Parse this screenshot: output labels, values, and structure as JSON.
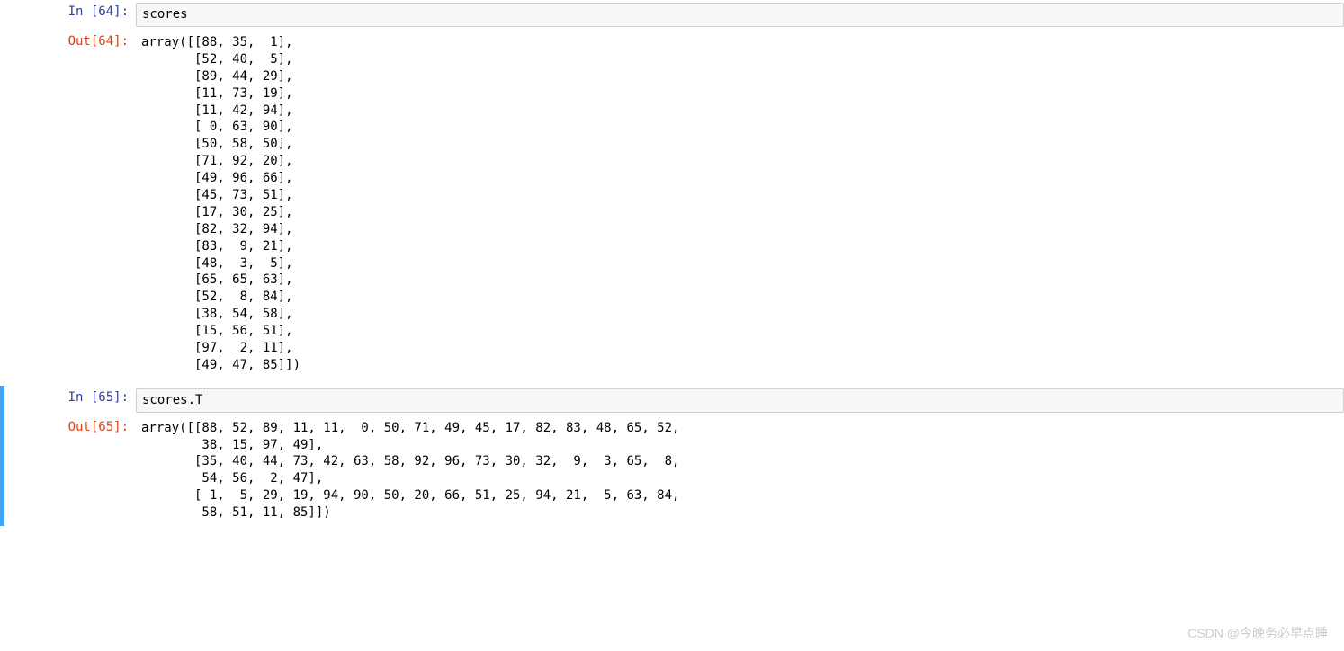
{
  "cells": [
    {
      "in_prompt_label": "In  [64]:",
      "out_prompt_label": "Out[64]:",
      "input_code": "scores",
      "output_text": "array([[88, 35,  1],\n       [52, 40,  5],\n       [89, 44, 29],\n       [11, 73, 19],\n       [11, 42, 94],\n       [ 0, 63, 90],\n       [50, 58, 50],\n       [71, 92, 20],\n       [49, 96, 66],\n       [45, 73, 51],\n       [17, 30, 25],\n       [82, 32, 94],\n       [83,  9, 21],\n       [48,  3,  5],\n       [65, 65, 63],\n       [52,  8, 84],\n       [38, 54, 58],\n       [15, 56, 51],\n       [97,  2, 11],\n       [49, 47, 85]])"
    },
    {
      "in_prompt_label": "In  [65]:",
      "out_prompt_label": "Out[65]:",
      "input_code": "scores.T",
      "output_text": "array([[88, 52, 89, 11, 11,  0, 50, 71, 49, 45, 17, 82, 83, 48, 65, 52,\n        38, 15, 97, 49],\n       [35, 40, 44, 73, 42, 63, 58, 92, 96, 73, 30, 32,  9,  3, 65,  8,\n        54, 56,  2, 47],\n       [ 1,  5, 29, 19, 94, 90, 50, 20, 66, 51, 25, 94, 21,  5, 63, 84,\n        58, 51, 11, 85]])"
    }
  ],
  "watermark": "CSDN @今晚务必早点睡"
}
